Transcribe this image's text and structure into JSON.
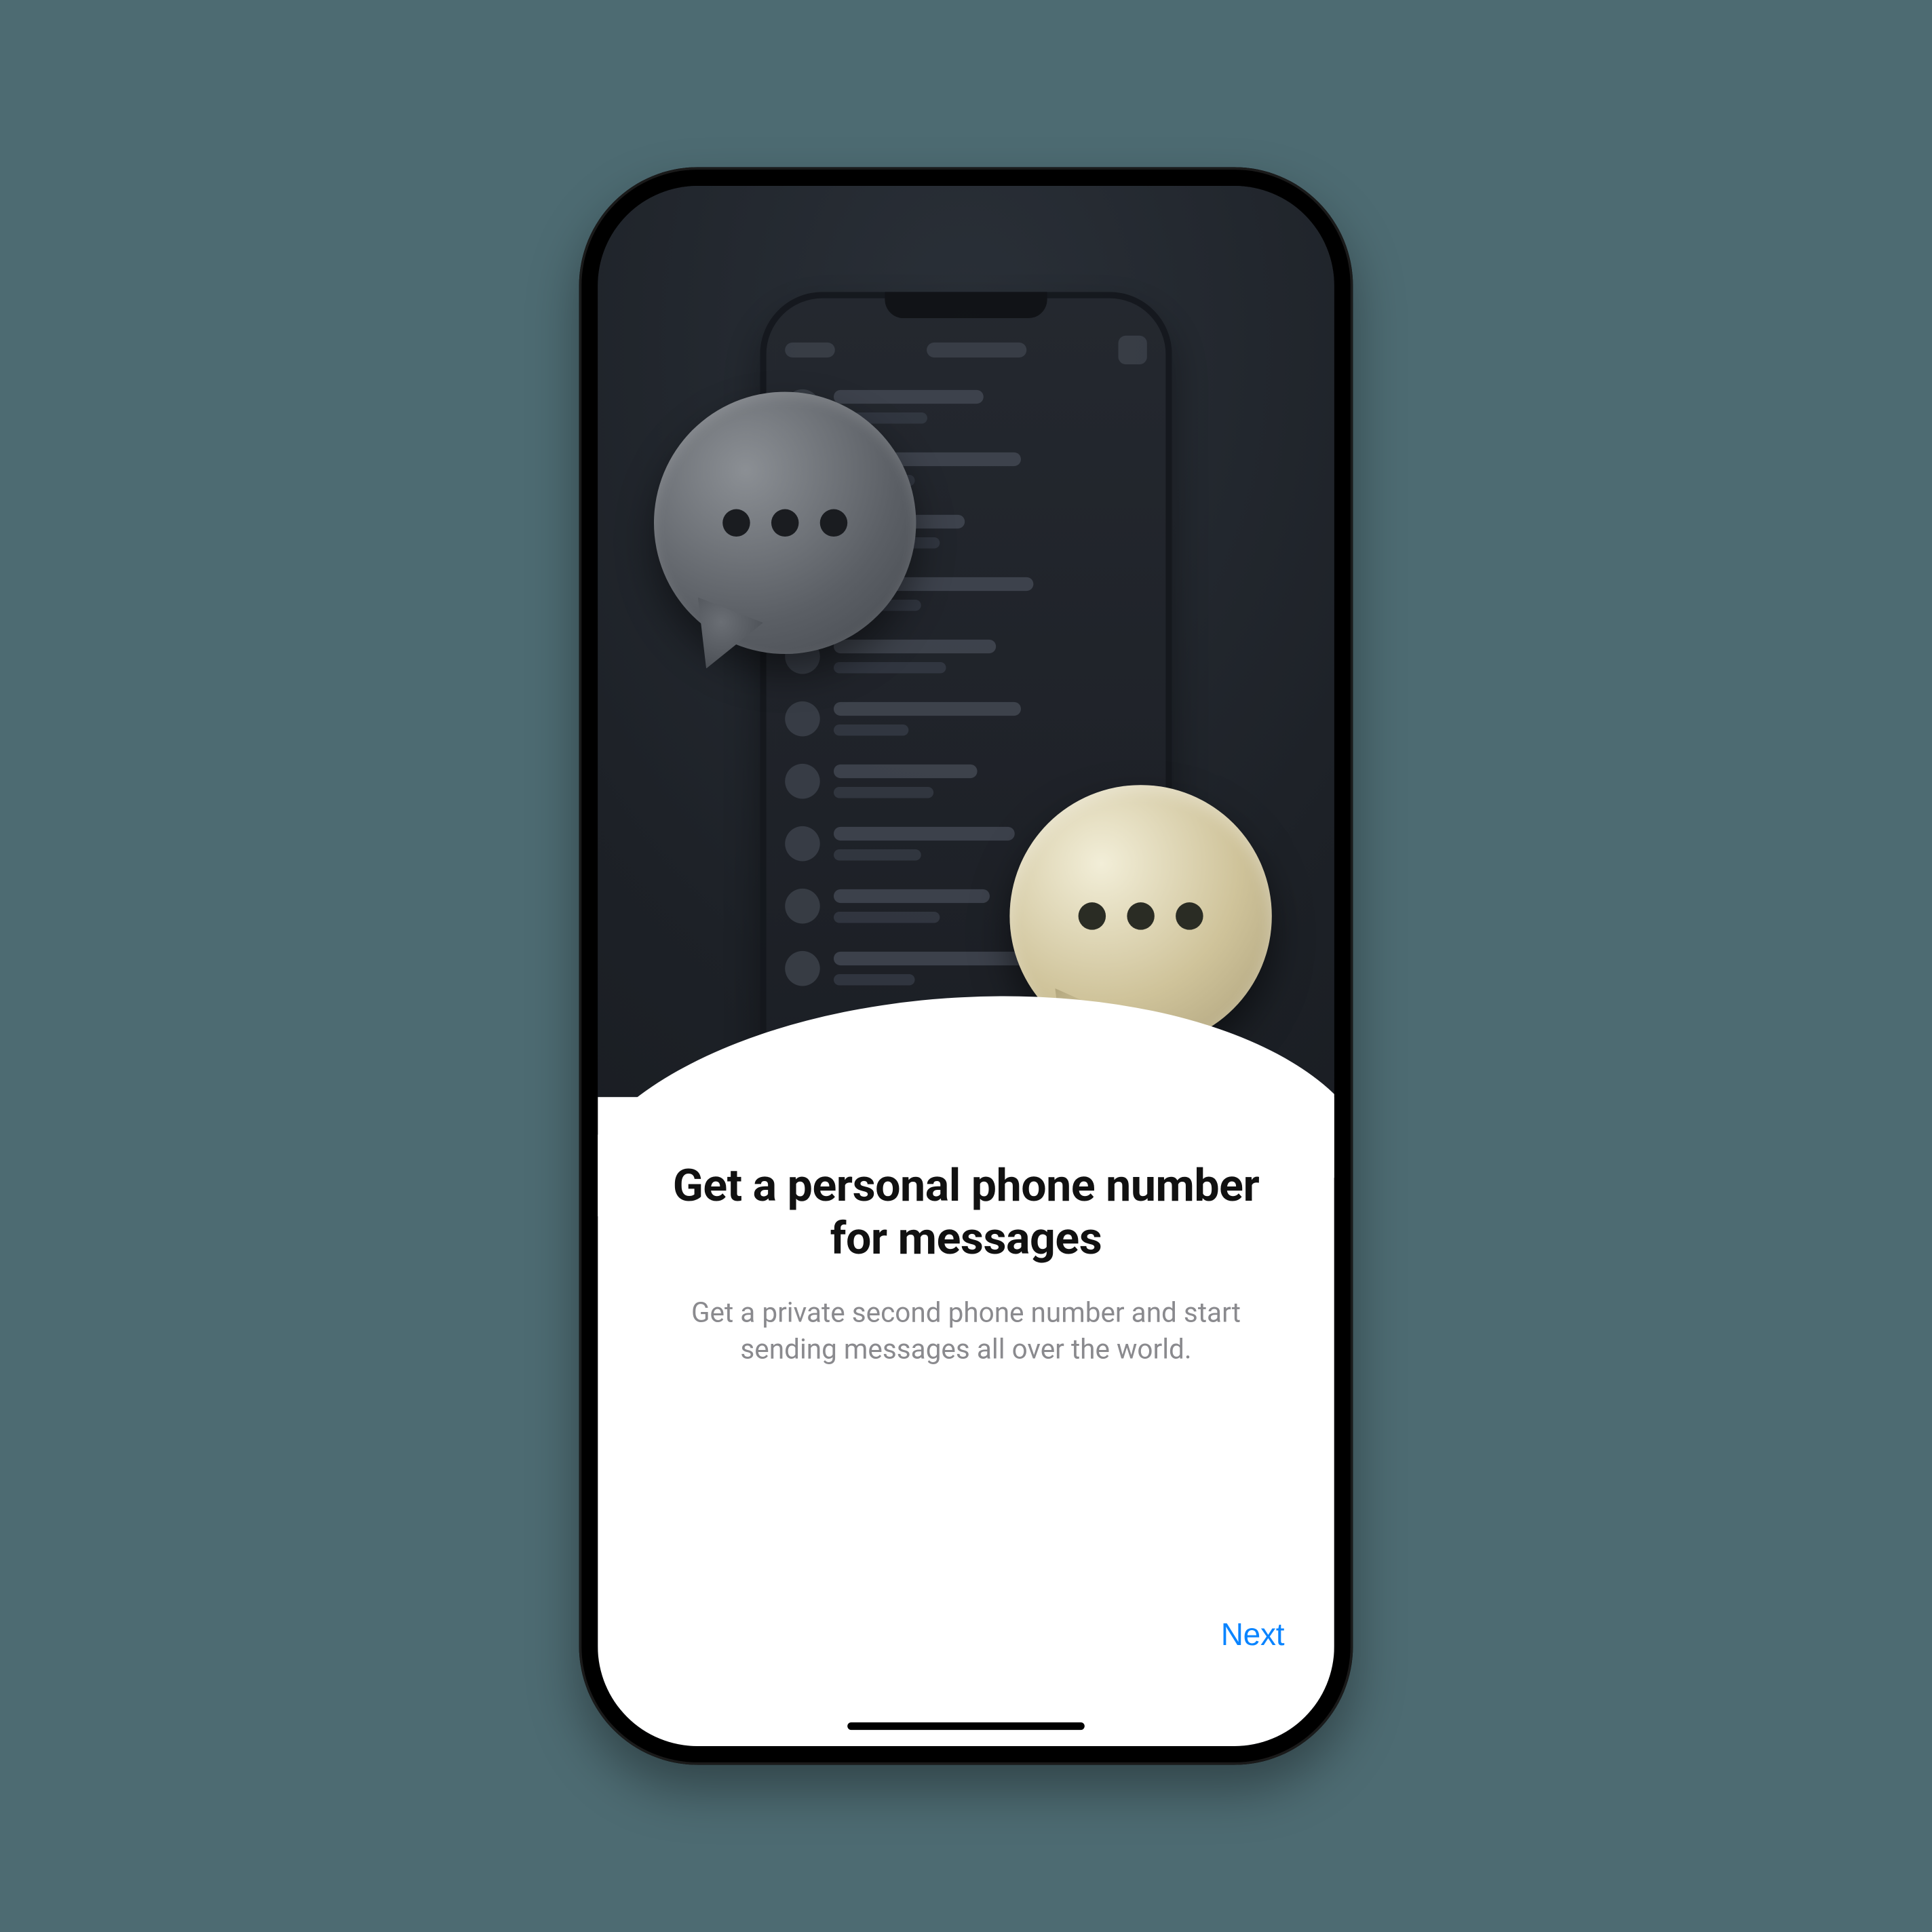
{
  "onboarding": {
    "title": "Get a personal phone number for messages",
    "subtitle": "Get a private second phone number and start sending messages all over the world.",
    "next_label": "Next"
  },
  "colors": {
    "background": "#4d6b72",
    "accent": "#0a84ff",
    "text_primary": "#111111",
    "text_secondary": "#8a8a8e"
  },
  "illustration": {
    "bubbles": [
      "grey-chat-bubble",
      "gold-chat-bubble"
    ]
  }
}
